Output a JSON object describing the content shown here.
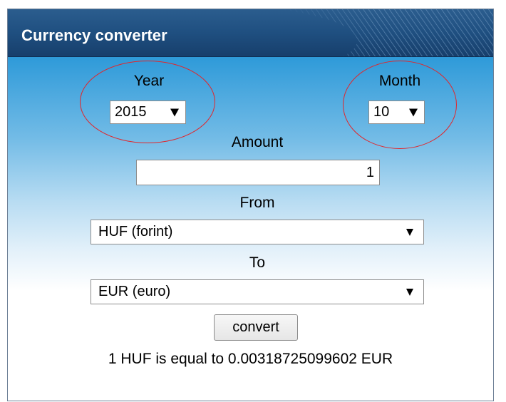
{
  "header": {
    "title": "Currency converter"
  },
  "year": {
    "label": "Year",
    "selected": "2015"
  },
  "month": {
    "label": "Month",
    "selected": "10"
  },
  "amount": {
    "label": "Amount",
    "value": "1"
  },
  "from": {
    "label": "From",
    "selected": "HUF (forint)"
  },
  "to": {
    "label": "To",
    "selected": "EUR (euro)"
  },
  "convert": {
    "label": "convert"
  },
  "result": {
    "text": "1 HUF is equal to 0.00318725099602 EUR"
  },
  "colors": {
    "header": "#1f4f80",
    "gradient_top": "#1689d0",
    "annotation": "#e2262b"
  }
}
